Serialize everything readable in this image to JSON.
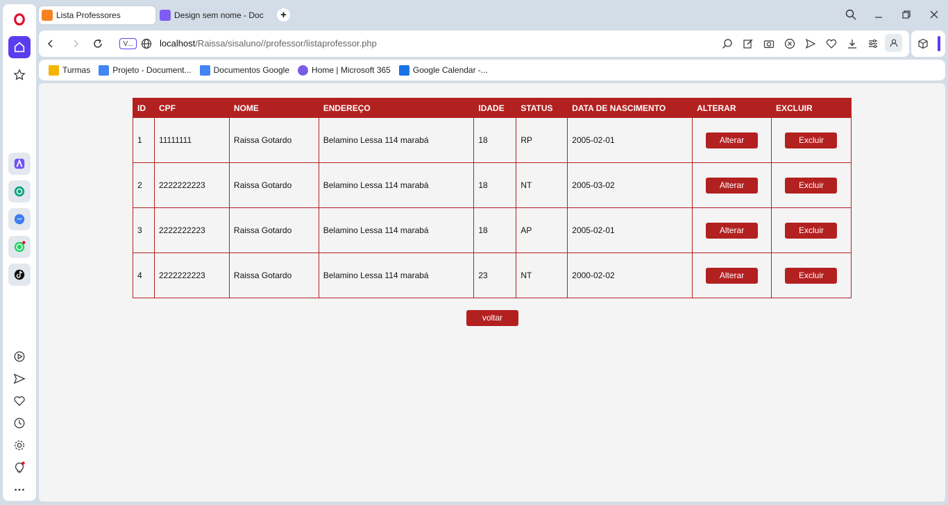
{
  "browser": {
    "tabs": [
      {
        "title": "Lista Professores",
        "active": true,
        "favicon_color": "#f5821f"
      },
      {
        "title": "Design sem nome - Doc",
        "active": false,
        "favicon_color": "#7d5cf2"
      }
    ],
    "address": {
      "vpn_label": "V...",
      "host": "localhost",
      "path": "/Raissa/sisaluno//professor/listaprofessor.php"
    },
    "bookmarks": [
      {
        "label": "Turmas",
        "color": "#f5b400"
      },
      {
        "label": "Projeto - Document...",
        "color": "#4285f4"
      },
      {
        "label": "Documentos Google",
        "color": "#4285f4"
      },
      {
        "label": "Home | Microsoft 365",
        "color": "#7b5ce6"
      },
      {
        "label": "Google Calendar -...",
        "color": "#1a73e8"
      }
    ],
    "accent": "#5b3df0"
  },
  "page": {
    "theme_color": "#b32020",
    "table": {
      "headers": [
        "ID",
        "CPF",
        "NOME",
        "ENDEREÇO",
        "IDADE",
        "STATUS",
        "DATA DE NASCIMENTO",
        "ALTERAR",
        "EXCLUIR"
      ],
      "rows": [
        {
          "id": "1",
          "cpf": "11111111",
          "nome": "Raissa Gotardo",
          "endereco": "Belamino Lessa 114 marabá",
          "idade": "18",
          "status": "RP",
          "nascimento": "2005-02-01"
        },
        {
          "id": "2",
          "cpf": "2222222223",
          "nome": "Raissa Gotardo",
          "endereco": "Belamino Lessa 114 marabá",
          "idade": "18",
          "status": "NT",
          "nascimento": "2005-03-02"
        },
        {
          "id": "3",
          "cpf": "2222222223",
          "nome": "Raissa Gotardo",
          "endereco": "Belamino Lessa 114 marabá",
          "idade": "18",
          "status": "AP",
          "nascimento": "2005-02-01"
        },
        {
          "id": "4",
          "cpf": "2222222223",
          "nome": "Raissa Gotardo",
          "endereco": "Belamino Lessa 114 marabá",
          "idade": "23",
          "status": "NT",
          "nascimento": "2000-02-02"
        }
      ],
      "alterar_label": "Alterar",
      "excluir_label": "Excluir"
    },
    "back_label": "voltar"
  }
}
